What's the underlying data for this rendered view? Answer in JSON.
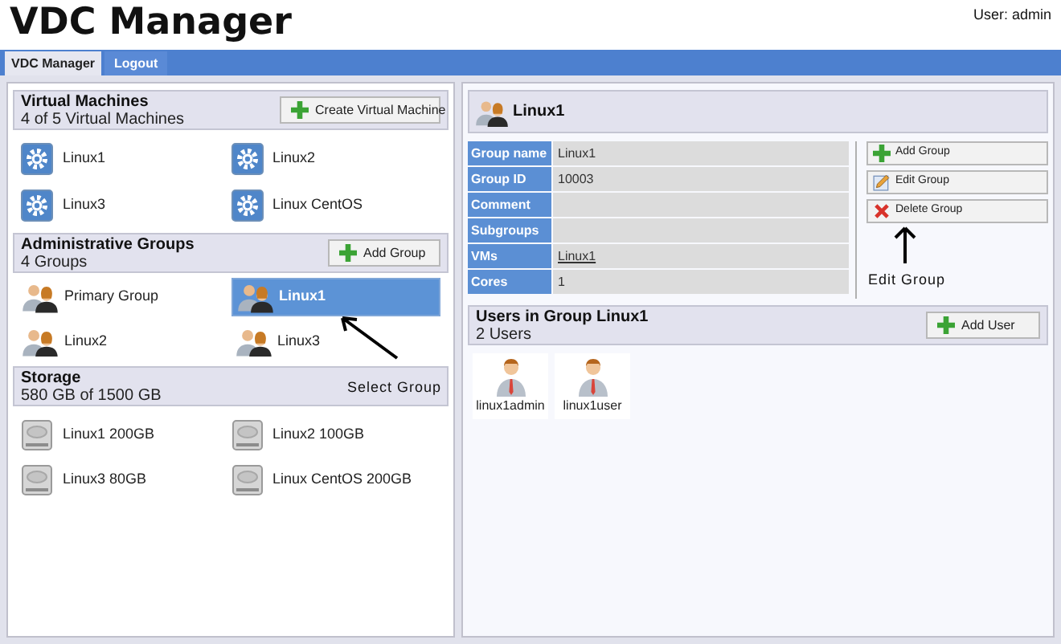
{
  "header": {
    "title": "VDC Manager",
    "user": "User: admin"
  },
  "tabs": [
    {
      "label": "VDC Manager",
      "selected": true
    },
    {
      "label": "Logout",
      "selected": false
    }
  ],
  "virtual_machines": {
    "title": "Virtual Machines",
    "subtitle": "4 of 5 Virtual Machines",
    "button": "Create Virtual Machine",
    "items": [
      {
        "label": "Linux1"
      },
      {
        "label": "Linux2"
      },
      {
        "label": "Linux3"
      },
      {
        "label": "Linux CentOS"
      }
    ]
  },
  "administrative_groups": {
    "title": "Administrative Groups",
    "subtitle": "4 Groups",
    "button": "Add Group",
    "items": [
      {
        "label": "Primary Group",
        "selected": false
      },
      {
        "label": "Linux1",
        "selected": true
      },
      {
        "label": "Linux2",
        "selected": false
      },
      {
        "label": "Linux3",
        "selected": false
      }
    ]
  },
  "storage": {
    "title": "Storage",
    "subtitle": "580 GB of 1500 GB",
    "items": [
      {
        "label": "Linux1 200GB"
      },
      {
        "label": "Linux2 100GB"
      },
      {
        "label": "Linux3 80GB"
      },
      {
        "label": "Linux CentOS 200GB"
      }
    ]
  },
  "group_detail": {
    "title": "Linux1",
    "rows": [
      {
        "label": "Group name",
        "value": "Linux1",
        "kind": "text"
      },
      {
        "label": "Group ID",
        "value": "10003",
        "kind": "text"
      },
      {
        "label": "Comment"
      },
      {
        "label": "Subgroups"
      },
      {
        "label": "VMs",
        "value": "Linux1",
        "kind": "link"
      },
      {
        "label": "Cores",
        "value": "1",
        "kind": "text"
      }
    ],
    "actions": [
      {
        "label": "Add Group",
        "kind": "add"
      },
      {
        "label": "Edit Group",
        "kind": "edit"
      },
      {
        "label": "Delete Group",
        "kind": "delete"
      }
    ]
  },
  "users_section": {
    "title": "Users in Group Linux1",
    "subtitle": "2 Users",
    "button": "Add User",
    "users": [
      {
        "label": "linux1admin"
      },
      {
        "label": "linux1user"
      }
    ]
  },
  "annotations": [
    {
      "text": "Select Group",
      "kind": "diagonal"
    },
    {
      "text": "Edit Group",
      "kind": "vertical"
    }
  ]
}
